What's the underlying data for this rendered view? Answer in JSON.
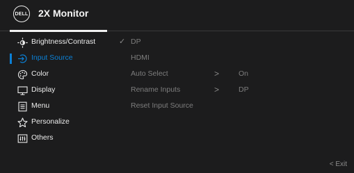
{
  "header": {
    "logo_text": "DELL",
    "title": "2X Monitor"
  },
  "menu": {
    "items": [
      {
        "label": "Brightness/Contrast",
        "icon": "brightness-icon"
      },
      {
        "label": "Input Source",
        "icon": "input-source-icon",
        "active": true
      },
      {
        "label": "Color",
        "icon": "palette-icon"
      },
      {
        "label": "Display",
        "icon": "monitor-icon"
      },
      {
        "label": "Menu",
        "icon": "menu-list-icon"
      },
      {
        "label": "Personalize",
        "icon": "star-icon"
      },
      {
        "label": "Others",
        "icon": "others-icon"
      }
    ]
  },
  "submenu": {
    "rows": [
      {
        "label": "DP",
        "checked": true
      },
      {
        "label": "HDMI"
      },
      {
        "label": "Auto Select",
        "arrow": ">",
        "value": "On"
      },
      {
        "label": "Rename Inputs",
        "arrow": ">",
        "value": "DP"
      },
      {
        "label": "Reset Input Source"
      }
    ],
    "check_glyph": "✓"
  },
  "footer": {
    "exit_label": "< Exit"
  },
  "colors": {
    "background": "#1c1c1d",
    "accent": "#0b80d6",
    "text": "#ececec",
    "muted": "#7e7e7e"
  }
}
